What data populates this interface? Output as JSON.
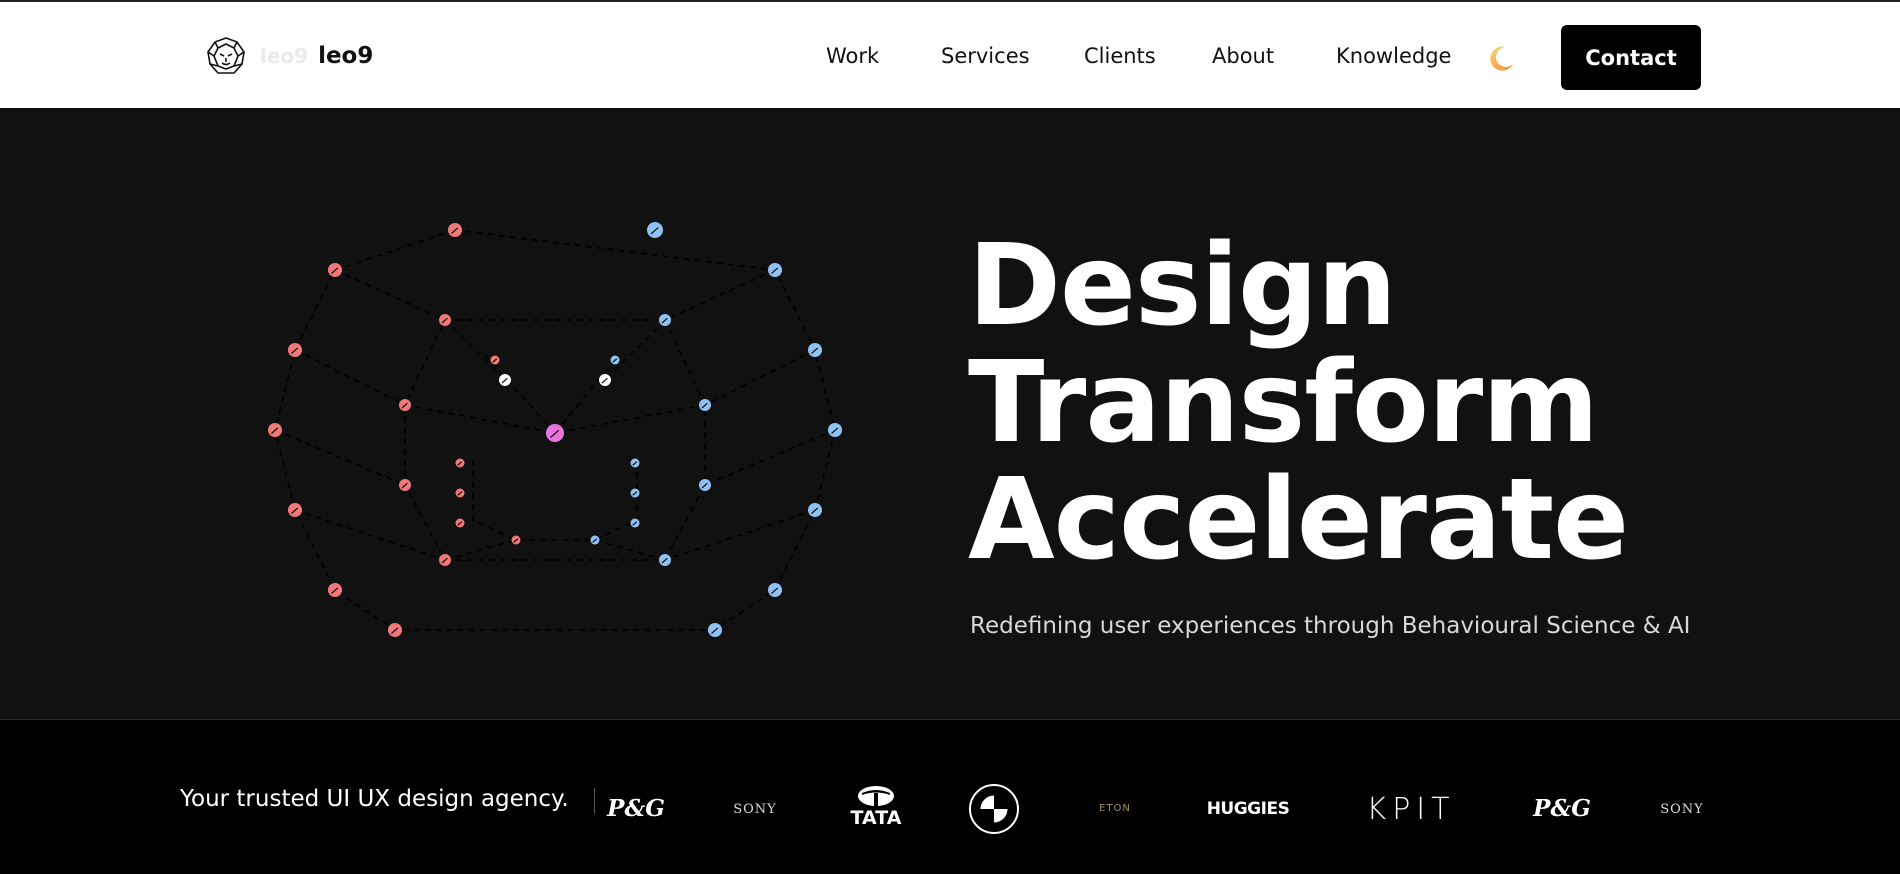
{
  "header": {
    "logo_ghost": "leo9",
    "logo_text": "leo9",
    "nav": [
      "Work",
      "Services",
      "Clients",
      "About",
      "Knowledge"
    ],
    "theme_toggle_icon": "moon-icon",
    "contact_label": "Contact"
  },
  "hero": {
    "headline": [
      "Design",
      "Transform",
      "Accelerate"
    ],
    "subtitle": "Redefining user experiences through Behavioural Science & AI"
  },
  "clients": {
    "tagline": "Your trusted UI UX design agency.",
    "logos": [
      "P&G",
      "SONY",
      "TATA",
      "BMW",
      "ETON",
      "HUGGIES",
      "KPIT",
      "P&G",
      "SONY"
    ]
  },
  "colors": {
    "accent_red": "#f07878",
    "accent_blue": "#8ec2f5",
    "accent_pink": "#e874e0",
    "hero_bg": "#111111",
    "strip_bg": "#000000"
  }
}
